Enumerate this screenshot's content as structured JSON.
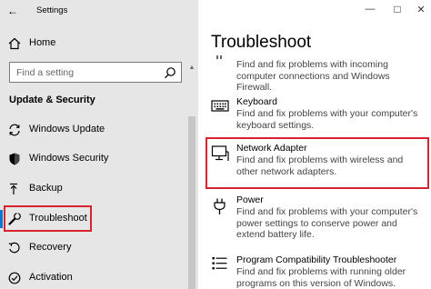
{
  "window": {
    "title": "Settings"
  },
  "nav": {
    "home_label": "Home",
    "search_placeholder": "Find a setting",
    "section_title": "Update & Security",
    "items": [
      {
        "label": "Windows Update",
        "icon": "sync-icon"
      },
      {
        "label": "Windows Security",
        "icon": "shield-icon"
      },
      {
        "label": "Backup",
        "icon": "backup-arrow-icon"
      },
      {
        "label": "Troubleshoot",
        "icon": "wrench-icon",
        "selected": true
      },
      {
        "label": "Recovery",
        "icon": "recovery-icon"
      },
      {
        "label": "Activation",
        "icon": "checkmark-circle-icon"
      }
    ]
  },
  "main": {
    "title": "Troubleshoot",
    "items": [
      {
        "name": "",
        "description": "Find and fix problems with incoming computer connections and Windows Firewall.",
        "icon": "firewall-icon"
      },
      {
        "name": "Keyboard",
        "description": "Find and fix problems with your computer's keyboard settings.",
        "icon": "keyboard-icon"
      },
      {
        "name": "Network Adapter",
        "description": "Find and fix problems with wireless and other network adapters.",
        "icon": "monitor-network-icon",
        "highlighted": true
      },
      {
        "name": "Power",
        "description": "Find and fix problems with your computer's power settings to conserve power and extend battery life.",
        "icon": "power-plug-icon"
      },
      {
        "name": "Program Compatibility Troubleshooter",
        "description": "Find and fix problems with running older programs on this version of Windows.",
        "icon": "program-list-icon"
      }
    ]
  },
  "colors": {
    "nav_background": "#e6e6e6",
    "accent": "#0078d7",
    "highlight_box": "#d7232d"
  }
}
